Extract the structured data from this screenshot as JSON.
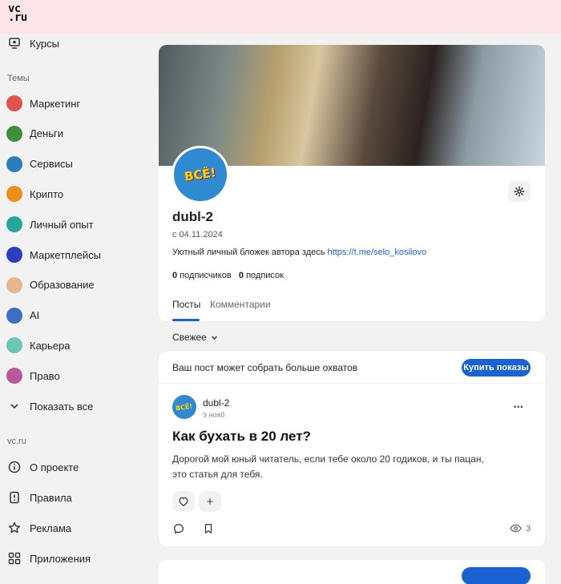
{
  "header": {
    "logo_top": "vc",
    "logo_bottom": ".ru"
  },
  "sidebar": {
    "courses": "Курсы",
    "topics_header": "Темы",
    "topics": [
      {
        "label": "Маркетинг",
        "icon": "marketing-icon",
        "color": "#e0534a"
      },
      {
        "label": "Деньги",
        "icon": "money-icon",
        "color": "#3e8e3e"
      },
      {
        "label": "Сервисы",
        "icon": "services-icon",
        "color": "#2a7fb8"
      },
      {
        "label": "Крипто",
        "icon": "crypto-icon",
        "color": "#f28c18"
      },
      {
        "label": "Личный опыт",
        "icon": "personal-experience-icon",
        "color": "#27a5a0"
      },
      {
        "label": "Маркетплейсы",
        "icon": "marketplaces-icon",
        "color": "#2b3fbf"
      },
      {
        "label": "Образование",
        "icon": "education-icon",
        "color": "#e6b58f"
      },
      {
        "label": "AI",
        "icon": "ai-icon",
        "color": "#3c6fc4"
      },
      {
        "label": "Карьера",
        "icon": "career-icon",
        "color": "#6cc6b6"
      },
      {
        "label": "Право",
        "icon": "law-icon",
        "color": "#b9579b"
      }
    ],
    "show_all": "Показать все",
    "site_header": "vc.ru",
    "site_links": [
      {
        "label": "О проекте",
        "icon": "info-icon"
      },
      {
        "label": "Правила",
        "icon": "rules-icon"
      },
      {
        "label": "Реклама",
        "icon": "star-icon"
      },
      {
        "label": "Приложения",
        "icon": "apps-icon"
      }
    ]
  },
  "profile": {
    "name": "dubl-2",
    "since": "с 04.11.2024",
    "bio_text": "Уютный личный бложек автора здесь ",
    "bio_link": "https://t.me/selo_kosilovo",
    "followers_count": "0",
    "followers_label": "подписчиков",
    "following_count": "0",
    "following_label": "подписок",
    "tabs": [
      "Посты",
      "Комментарии"
    ],
    "active_tab": "Посты",
    "avatar_text": "ВСЁ!"
  },
  "sort": {
    "label": "Свежее"
  },
  "promo": {
    "text": "Ваш пост может собрать больше охватов",
    "button": "Купить показы"
  },
  "post": {
    "author": "dubl-2",
    "date": "9 нояб",
    "title": "Как бухать в 20 лет?",
    "body_line1": "Дорогой мой юный читатель, если тебе около 20 годиков, и ты пацан,",
    "body_line2": "это статья для тебя.",
    "views": "3",
    "more": "•••",
    "add": "+"
  },
  "colors": {
    "accent": "#1a61d1",
    "header_bg": "#fce4e8",
    "page_bg": "#f2f2f2"
  }
}
